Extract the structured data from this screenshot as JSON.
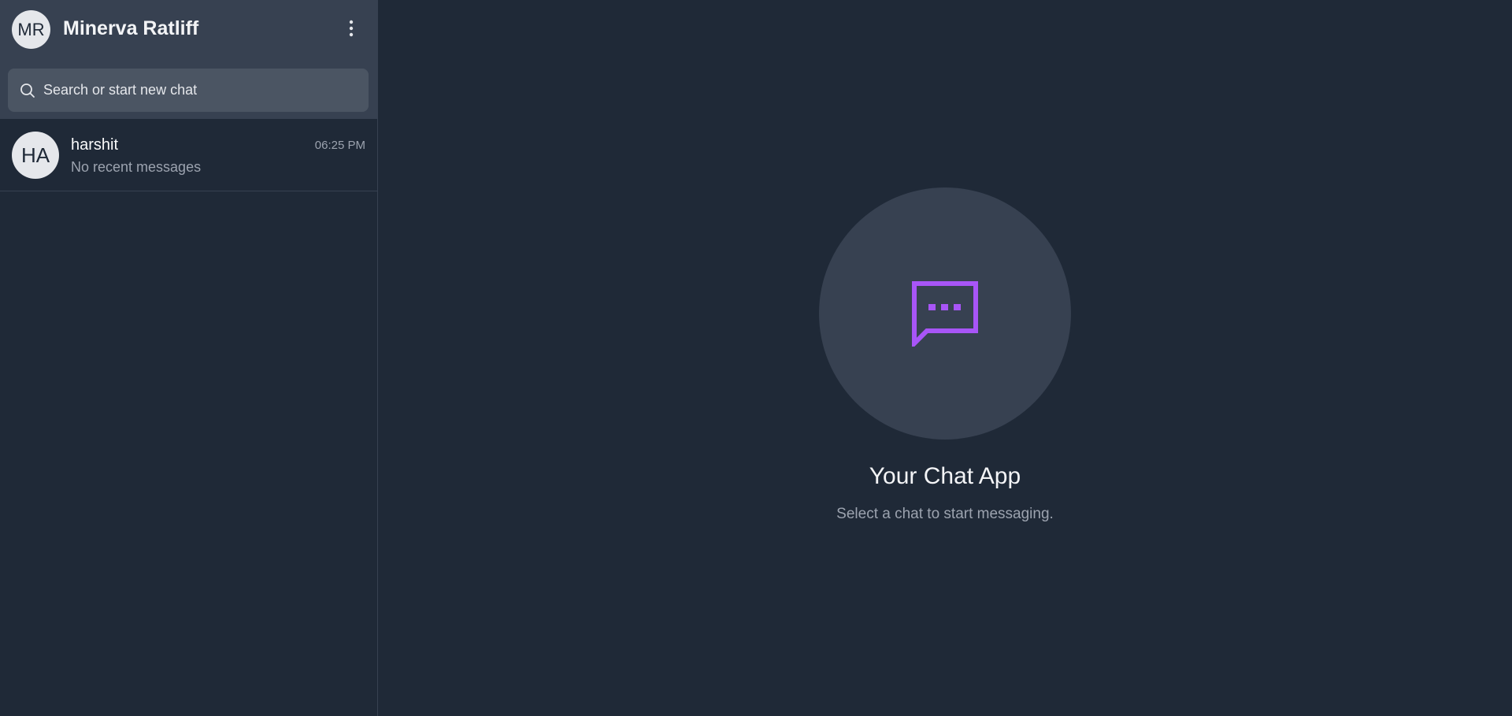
{
  "profile": {
    "initials": "MR",
    "name": "Minerva Ratliff",
    "menu_icon": "more-vertical-icon"
  },
  "search": {
    "placeholder": "Search or start new chat",
    "value": "",
    "icon": "search-icon"
  },
  "chats": [
    {
      "initials": "HA",
      "name": "harshit",
      "time": "06:25 PM",
      "preview": "No recent messages"
    }
  ],
  "empty_state": {
    "icon": "message-bubble-icon",
    "title": "Your Chat App",
    "subtitle": "Select a chat to start messaging."
  },
  "colors": {
    "accent": "#a855f7",
    "background": "#1f2937",
    "panel": "#374151",
    "search_bg": "#4b5563"
  }
}
